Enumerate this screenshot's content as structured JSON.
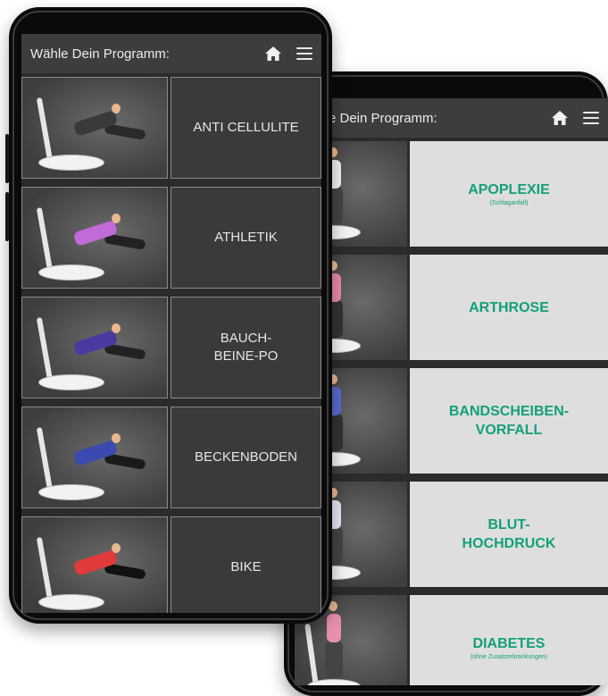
{
  "left_phone": {
    "header": {
      "title": "Wähle Dein Programm:",
      "home_icon": "home-icon",
      "menu_icon": "hamburger-menu-icon"
    },
    "programs": [
      {
        "label": "ANTI CELLULITE",
        "shirt": "#3a3a3a",
        "pants": "#2a2a2a"
      },
      {
        "label": "ATHLETIK",
        "shirt": "#c06bd8",
        "pants": "#222222"
      },
      {
        "label": "BAUCH-\nBEINE-PO",
        "shirt": "#4a3aa0",
        "pants": "#222222"
      },
      {
        "label": "BECKENBODEN",
        "shirt": "#3a4ab0",
        "pants": "#1a1a1a"
      },
      {
        "label": "BIKE",
        "shirt": "#e03a3a",
        "pants": "#111111"
      }
    ]
  },
  "right_phone": {
    "header": {
      "title": "e Dein Programm:",
      "home_icon": "home-icon",
      "menu_icon": "hamburger-menu-icon"
    },
    "programs": [
      {
        "label": "APOPLEXIE",
        "sub": "(Schlaganfall)",
        "shirt": "#f2f2f2",
        "pants": "#444444"
      },
      {
        "label": "ARTHROSE",
        "sub": "",
        "shirt": "#e88aa8",
        "pants": "#333333"
      },
      {
        "label": "BANDSCHEIBEN-\nVORFALL",
        "sub": "",
        "shirt": "#5a6ad0",
        "pants": "#333333"
      },
      {
        "label": "BLUT-\nHOCHDRUCK",
        "sub": "",
        "shirt": "#e6e6f0",
        "pants": "#444444"
      },
      {
        "label": "DIABETES",
        "sub": "(ohne Zusatzerkrankungen)",
        "shirt": "#e890b0",
        "pants": "#444444"
      }
    ]
  }
}
